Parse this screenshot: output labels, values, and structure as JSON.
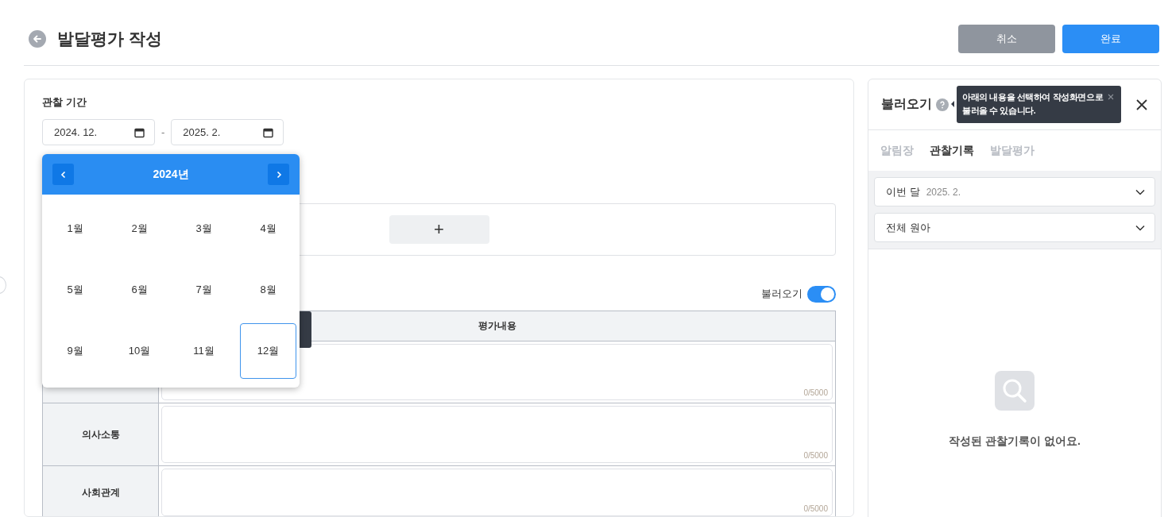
{
  "header": {
    "title": "발달평가 작성",
    "buttons": [
      {
        "label": "취소",
        "kind": "secondary"
      },
      {
        "label": "완료",
        "kind": "primary"
      }
    ]
  },
  "period": {
    "label": "관찰 기간",
    "start": "2024. 12.",
    "separator": "-",
    "end": "2025. 2."
  },
  "month_picker": {
    "year": "2024년",
    "months": [
      {
        "label": "1월",
        "selected": false
      },
      {
        "label": "2월",
        "selected": false
      },
      {
        "label": "3월",
        "selected": false
      },
      {
        "label": "4월",
        "selected": false
      },
      {
        "label": "5월",
        "selected": false
      },
      {
        "label": "6월",
        "selected": false
      },
      {
        "label": "7월",
        "selected": false
      },
      {
        "label": "8월",
        "selected": false
      },
      {
        "label": "9월",
        "selected": false
      },
      {
        "label": "10월",
        "selected": false
      },
      {
        "label": "11월",
        "selected": false
      },
      {
        "label": "12월",
        "selected": true
      }
    ]
  },
  "add_button": "+",
  "load_toggle": {
    "label": "불러오기",
    "on": true
  },
  "table": {
    "column": "평가내용",
    "rows": [
      {
        "counter": "0/5000"
      },
      {
        "area": "의사소통",
        "counter": "0/5000"
      },
      {
        "area": "사회관계",
        "counter": "0/5000"
      }
    ]
  },
  "side_panel": {
    "title": "불러오기",
    "tooltip": "아래의 내용을 선택하여 작성화면으로 불러올 수 있습니다.",
    "tabs": [
      {
        "label": "알림장",
        "selected": false
      },
      {
        "label": "관찰기록",
        "selected": true
      },
      {
        "label": "발달평가",
        "selected": false
      }
    ],
    "filters": [
      {
        "label": "이번 달",
        "value": "2025. 2."
      },
      {
        "label": "전체 원아"
      }
    ],
    "empty_message": "작성된 관찰기록이 없어요."
  }
}
